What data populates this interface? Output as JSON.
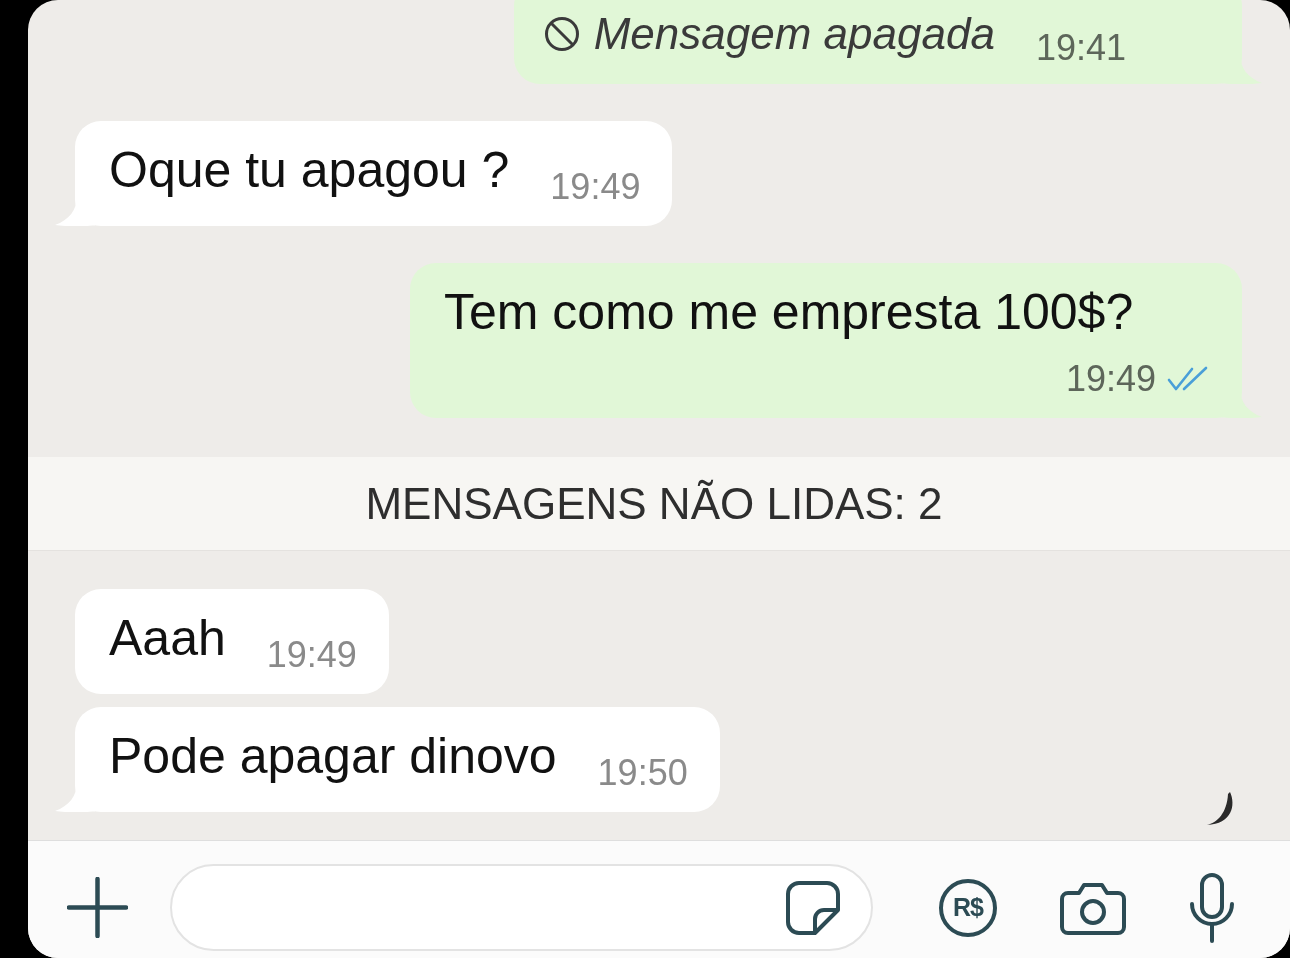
{
  "chat": [
    {
      "kind": "message",
      "outgoing": true,
      "deleted": true,
      "text": "Mensagem apagada",
      "time": "19:41",
      "tail": true
    },
    {
      "kind": "message",
      "outgoing": false,
      "deleted": false,
      "text": "Oque tu apagou ?",
      "time": "19:49",
      "tail": true
    },
    {
      "kind": "message",
      "outgoing": true,
      "deleted": false,
      "text": "Tem como me empresta 100$?",
      "time": "19:49",
      "tail": true,
      "read": true
    },
    {
      "kind": "divider",
      "label": "MENSAGENS NÃO LIDAS: 2"
    },
    {
      "kind": "message",
      "outgoing": false,
      "deleted": false,
      "text": "Aaah",
      "time": "19:49",
      "tail": false
    },
    {
      "kind": "message",
      "outgoing": false,
      "deleted": false,
      "text": "Pode apagar dinovo",
      "time": "19:50",
      "tail": true
    }
  ],
  "composer": {
    "payment_label": "R$"
  }
}
